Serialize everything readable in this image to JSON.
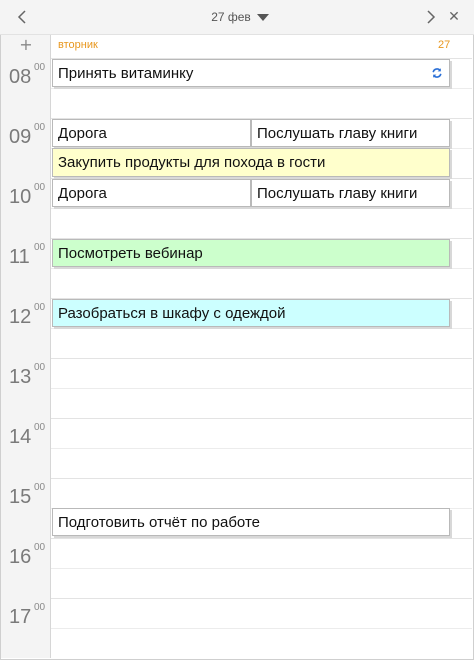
{
  "header": {
    "date_label": "27 фев"
  },
  "day": {
    "name": "вторник",
    "number": "27"
  },
  "hours": [
    {
      "h": "08",
      "m": "00"
    },
    {
      "h": "09",
      "m": "00"
    },
    {
      "h": "10",
      "m": "00"
    },
    {
      "h": "11",
      "m": "00"
    },
    {
      "h": "12",
      "m": "00"
    },
    {
      "h": "13",
      "m": "00"
    },
    {
      "h": "14",
      "m": "00"
    },
    {
      "h": "15",
      "m": "00"
    },
    {
      "h": "16",
      "m": "00"
    },
    {
      "h": "17",
      "m": "00"
    }
  ],
  "events": [
    {
      "title": "Принять витаминку",
      "color": "#ffffff",
      "recurring": true
    },
    {
      "title": "Дорога",
      "color": "#ffffff"
    },
    {
      "title": "Послушать главу книги",
      "color": "#ffffff"
    },
    {
      "title": "Закупить продукты для похода в гости",
      "color": "#ffffcc"
    },
    {
      "title": "Дорога",
      "color": "#ffffff"
    },
    {
      "title": "Послушать главу книги",
      "color": "#ffffff"
    },
    {
      "title": "Посмотреть вебинар",
      "color": "#ccffcc"
    },
    {
      "title": "Разобраться в шкафу с одеждой",
      "color": "#ccffff"
    },
    {
      "title": "Подготовить отчёт по работе",
      "color": "#ffffff"
    }
  ],
  "colors": {
    "accent": "#e8971e",
    "recurring_icon": "#2a6fd6"
  }
}
